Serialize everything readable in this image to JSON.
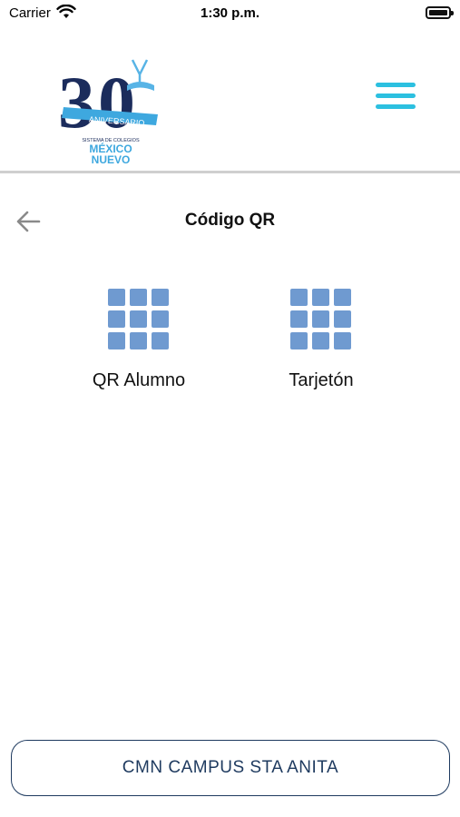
{
  "status_bar": {
    "carrier": "Carrier",
    "time": "1:30 p.m."
  },
  "header": {
    "logo_text": [
      "30",
      "ANIVERSARIO",
      "SISTEMA DE COLEGIOS",
      "MÉXICO",
      "NUEVO"
    ],
    "menu_icon": "hamburger-menu-icon",
    "menu_color": "#2cc0e0"
  },
  "nav": {
    "back_icon": "arrow-left-icon",
    "title": "Código QR"
  },
  "options": [
    {
      "label": "QR Alumno",
      "icon": "grid-icon"
    },
    {
      "label": "Tarjetón",
      "icon": "grid-icon"
    }
  ],
  "footer": {
    "campus_label": "CMN CAMPUS STA ANITA"
  },
  "colors": {
    "brand_navy": "#1e3a5f",
    "grid_blue": "#6f9ad0",
    "accent_cyan": "#2cc0e0"
  }
}
